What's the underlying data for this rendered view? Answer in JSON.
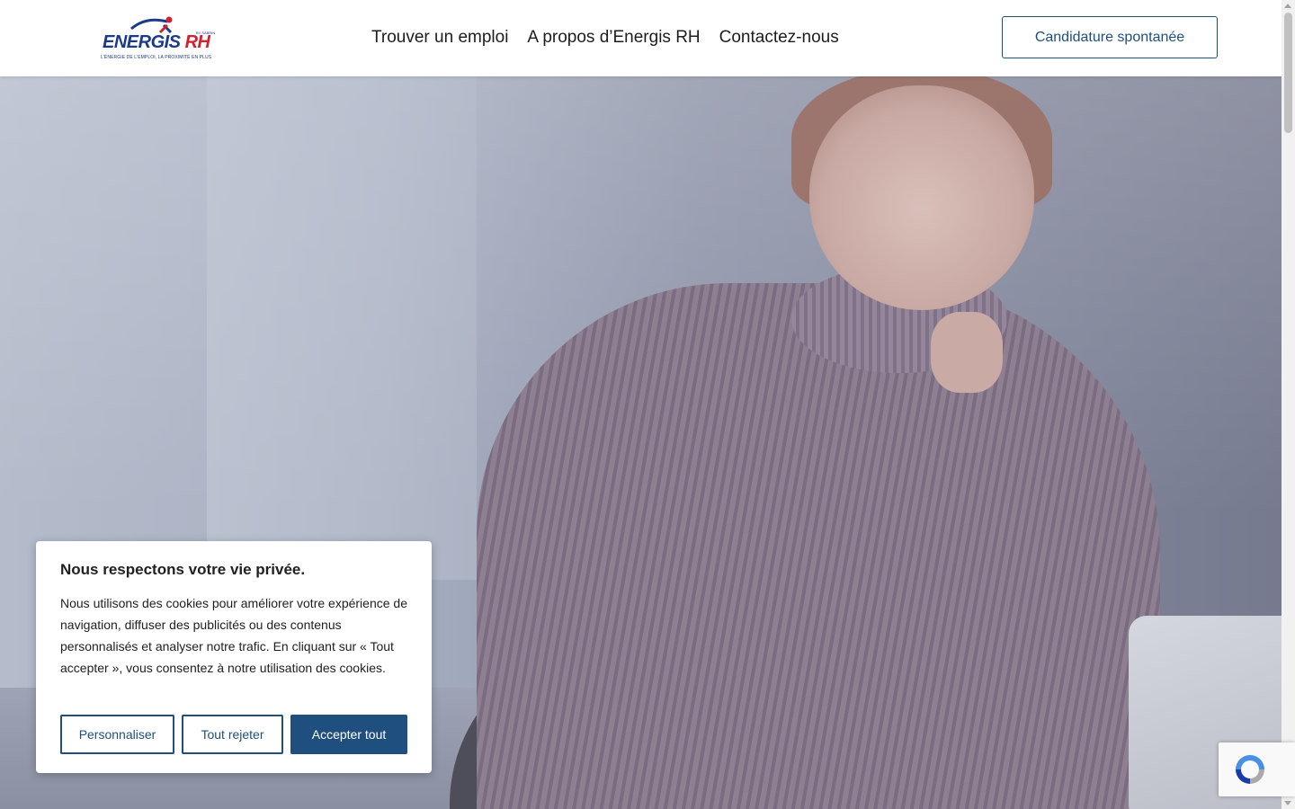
{
  "header": {
    "logo": {
      "word_main": "ENERGIS",
      "word_accent": "RH",
      "tagline": "L'ÉNERGIE DE L'EMPLOI, LA PROXIMITÉ EN PLUS",
      "byline": "BY SABRIN"
    },
    "nav": [
      {
        "label": "Trouver un emploi"
      },
      {
        "label": "A propos d’Energis RH"
      },
      {
        "label": "Contactez-nous"
      }
    ],
    "cta_label": "Candidature spontanée"
  },
  "cookie_banner": {
    "title": "Nous respectons votre vie privée.",
    "body": "Nous utilisons des cookies pour améliorer votre expérience de navigation, diffuser des publicités ou des contenus personnalisés et analyser notre trafic. En cliquant sur « Tout accepter », vous consentez à notre utilisation des cookies.",
    "customize_label": "Personnaliser",
    "reject_label": "Tout rejeter",
    "accept_label": "Accepter tout"
  },
  "colors": {
    "brand_blue": "#1f4f7e",
    "logo_blue": "#1b3a8c",
    "logo_red": "#d3202f"
  },
  "icons": {
    "recaptcha": "recaptcha-icon"
  }
}
